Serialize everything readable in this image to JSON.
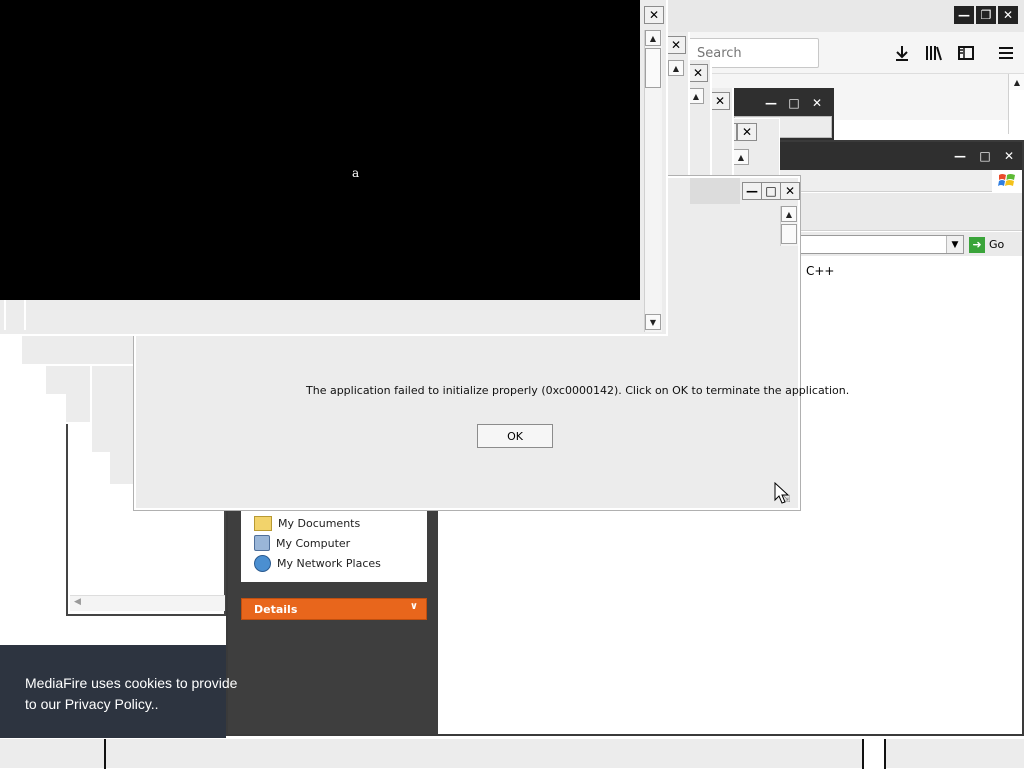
{
  "firefox": {
    "search_placeholder": "Search",
    "icons": [
      "download-icon",
      "library-icon",
      "sidebar-icon",
      "menu-icon"
    ]
  },
  "explorer": {
    "address_fragment": "C++",
    "go_label": "Go",
    "places": [
      "My Documents",
      "My Computer",
      "My Network Places"
    ],
    "details_label": "Details"
  },
  "console": {
    "text": "a"
  },
  "dialog": {
    "message": "The application failed to initialize properly (0xc0000142). Click on OK to terminate the application.",
    "ok_label": "OK"
  },
  "cookie_banner": {
    "line1": "MediaFire uses cookies to provide",
    "line2": "to our Privacy Policy.."
  },
  "colors": {
    "details_orange": "#e8661c",
    "sidebar_dark": "#3e3e3e",
    "banner_bg": "#2d3440",
    "go_green": "#3aa43a"
  }
}
